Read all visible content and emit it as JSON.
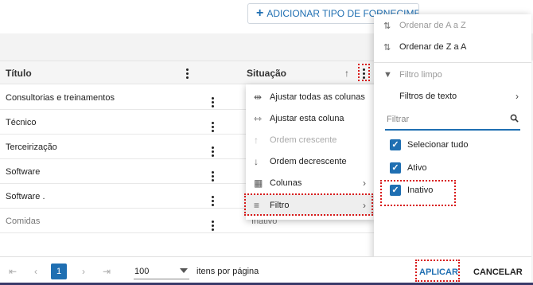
{
  "toolbar": {
    "add_label": "ADICIONAR TIPO DE FORNECIMENTO"
  },
  "grid": {
    "columns": {
      "titulo": "Título",
      "situacao": "Situação"
    },
    "rows": [
      {
        "title": "Consultorias e treinamentos",
        "situacao": ""
      },
      {
        "title": "Técnico",
        "situacao": ""
      },
      {
        "title": "Terceirização",
        "situacao": ""
      },
      {
        "title": "Software",
        "situacao": ""
      },
      {
        "title": "Software .",
        "situacao": ""
      },
      {
        "title": "Comidas",
        "situacao": "Inativo"
      }
    ]
  },
  "column_menu": {
    "items": [
      {
        "label": "Ajustar todas as colunas",
        "icon": "autosize-all-icon"
      },
      {
        "label": "Ajustar esta coluna",
        "icon": "autosize-column-icon"
      },
      {
        "label": "Ordem crescente",
        "icon": "arrow-up-icon"
      },
      {
        "label": "Ordem decrescente",
        "icon": "arrow-down-icon"
      },
      {
        "label": "Colunas",
        "icon": "columns-icon"
      },
      {
        "label": "Filtro",
        "icon": "filter-icon"
      }
    ]
  },
  "filter_panel": {
    "sort_asc": "Ordenar de A a Z",
    "sort_desc": "Ordenar de Z a A",
    "clear_filter": "Filtro limpo",
    "text_filters": "Filtros de texto",
    "search_placeholder": "Filtrar",
    "options": [
      {
        "label": "Selecionar tudo",
        "checked": true
      },
      {
        "label": "Ativo",
        "checked": true
      },
      {
        "label": "Inativo",
        "checked": true
      }
    ],
    "apply_label": "APLICAR",
    "cancel_label": "CANCELAR"
  },
  "pager": {
    "current_page": "1",
    "page_size": "100",
    "per_page_label": "itens por página"
  },
  "colors": {
    "accent": "#1f6fb2",
    "highlight": "#d81b1b"
  }
}
